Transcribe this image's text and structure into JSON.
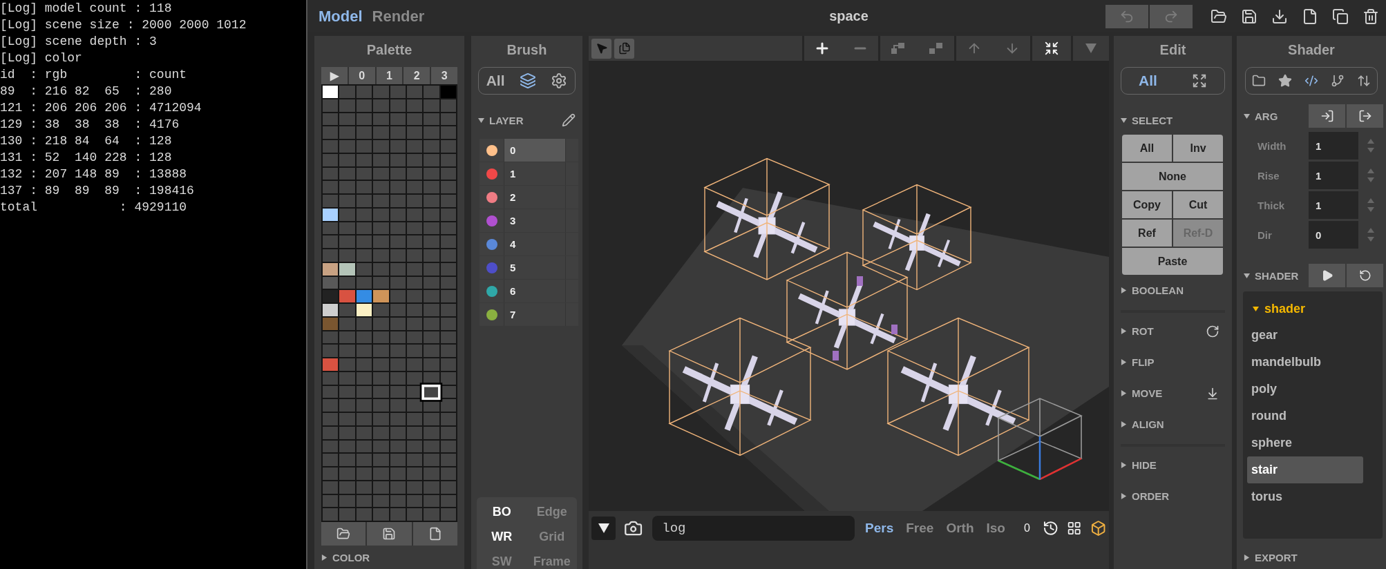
{
  "log": {
    "lines": [
      "[Log] model count : 118",
      "[Log] scene size : 2000 2000 1012",
      "[Log] scene depth : 3",
      "[Log] color",
      "id  : rgb         : count",
      "89  : 216 82  65  : 280",
      "121 : 206 206 206 : 4712094",
      "129 : 38  38  38  : 4176",
      "130 : 218 84  64  : 128",
      "131 : 52  140 228 : 128",
      "132 : 207 148 89  : 13888",
      "137 : 89  89  89  : 198416",
      "total           : 4929110"
    ]
  },
  "topbar": {
    "mode_tabs": [
      {
        "label": "Model",
        "selected": true
      },
      {
        "label": "Render",
        "selected": false
      }
    ],
    "title": "space",
    "history_buttons": [
      {
        "disabled": true
      },
      {
        "disabled": true
      }
    ]
  },
  "palette": {
    "title": "Palette",
    "pages": [
      "▶",
      "0",
      "1",
      "2",
      "3"
    ],
    "swatch_rows": [
      [
        {
          "color": "#ffffff",
          "selected": false
        },
        {
          "color": "#454545",
          "selected": false
        },
        {
          "color": "#454545",
          "selected": false
        },
        {
          "color": "#454545",
          "selected": false
        },
        {
          "color": "#454545",
          "selected": false
        },
        {
          "color": "#454545",
          "selected": false
        },
        {
          "color": "#454545",
          "selected": false
        },
        {
          "color": "#000000",
          "selected": false
        }
      ],
      [
        {
          "color": "#454545",
          "selected": false
        },
        {
          "color": "#454545",
          "selected": false
        },
        {
          "color": "#454545",
          "selected": false
        },
        {
          "color": "#454545",
          "selected": false
        },
        {
          "color": "#454545",
          "selected": false
        },
        {
          "color": "#454545",
          "selected": false
        },
        {
          "color": "#454545",
          "selected": false
        },
        {
          "color": "#454545",
          "selected": false
        }
      ],
      [
        {
          "color": "#454545",
          "selected": false
        },
        {
          "color": "#454545",
          "selected": false
        },
        {
          "color": "#454545",
          "selected": false
        },
        {
          "color": "#454545",
          "selected": false
        },
        {
          "color": "#454545",
          "selected": false
        },
        {
          "color": "#454545",
          "selected": false
        },
        {
          "color": "#454545",
          "selected": false
        },
        {
          "color": "#454545",
          "selected": false
        }
      ],
      [
        {
          "color": "#454545",
          "selected": false
        },
        {
          "color": "#454545",
          "selected": false
        },
        {
          "color": "#454545",
          "selected": false
        },
        {
          "color": "#454545",
          "selected": false
        },
        {
          "color": "#454545",
          "selected": false
        },
        {
          "color": "#454545",
          "selected": false
        },
        {
          "color": "#454545",
          "selected": false
        },
        {
          "color": "#454545",
          "selected": false
        }
      ],
      [
        {
          "color": "#454545",
          "selected": false
        },
        {
          "color": "#454545",
          "selected": false
        },
        {
          "color": "#454545",
          "selected": false
        },
        {
          "color": "#454545",
          "selected": false
        },
        {
          "color": "#454545",
          "selected": false
        },
        {
          "color": "#454545",
          "selected": false
        },
        {
          "color": "#454545",
          "selected": false
        },
        {
          "color": "#454545",
          "selected": false
        }
      ],
      [
        {
          "color": "#454545",
          "selected": false
        },
        {
          "color": "#454545",
          "selected": false
        },
        {
          "color": "#454545",
          "selected": false
        },
        {
          "color": "#454545",
          "selected": false
        },
        {
          "color": "#454545",
          "selected": false
        },
        {
          "color": "#454545",
          "selected": false
        },
        {
          "color": "#454545",
          "selected": false
        },
        {
          "color": "#454545",
          "selected": false
        }
      ],
      [
        {
          "color": "#454545",
          "selected": false
        },
        {
          "color": "#454545",
          "selected": false
        },
        {
          "color": "#454545",
          "selected": false
        },
        {
          "color": "#454545",
          "selected": false
        },
        {
          "color": "#454545",
          "selected": false
        },
        {
          "color": "#454545",
          "selected": false
        },
        {
          "color": "#454545",
          "selected": false
        },
        {
          "color": "#454545",
          "selected": false
        }
      ],
      [
        {
          "color": "#454545",
          "selected": false
        },
        {
          "color": "#454545",
          "selected": false
        },
        {
          "color": "#454545",
          "selected": false
        },
        {
          "color": "#454545",
          "selected": false
        },
        {
          "color": "#454545",
          "selected": false
        },
        {
          "color": "#454545",
          "selected": false
        },
        {
          "color": "#454545",
          "selected": false
        },
        {
          "color": "#454545",
          "selected": false
        }
      ],
      [
        {
          "color": "#454545",
          "selected": false
        },
        {
          "color": "#454545",
          "selected": false
        },
        {
          "color": "#454545",
          "selected": false
        },
        {
          "color": "#454545",
          "selected": false
        },
        {
          "color": "#454545",
          "selected": false
        },
        {
          "color": "#454545",
          "selected": false
        },
        {
          "color": "#454545",
          "selected": false
        },
        {
          "color": "#454545",
          "selected": false
        }
      ],
      [
        {
          "color": "#a8d0ff",
          "selected": false
        },
        {
          "color": "#454545",
          "selected": false
        },
        {
          "color": "#454545",
          "selected": false
        },
        {
          "color": "#454545",
          "selected": false
        },
        {
          "color": "#454545",
          "selected": false
        },
        {
          "color": "#454545",
          "selected": false
        },
        {
          "color": "#454545",
          "selected": false
        },
        {
          "color": "#454545",
          "selected": false
        }
      ],
      [
        {
          "color": "#454545",
          "selected": false
        },
        {
          "color": "#454545",
          "selected": false
        },
        {
          "color": "#454545",
          "selected": false
        },
        {
          "color": "#454545",
          "selected": false
        },
        {
          "color": "#454545",
          "selected": false
        },
        {
          "color": "#454545",
          "selected": false
        },
        {
          "color": "#454545",
          "selected": false
        },
        {
          "color": "#454545",
          "selected": false
        }
      ],
      [
        {
          "color": "#454545",
          "selected": false
        },
        {
          "color": "#454545",
          "selected": false
        },
        {
          "color": "#454545",
          "selected": false
        },
        {
          "color": "#454545",
          "selected": false
        },
        {
          "color": "#454545",
          "selected": false
        },
        {
          "color": "#454545",
          "selected": false
        },
        {
          "color": "#454545",
          "selected": false
        },
        {
          "color": "#454545",
          "selected": false
        }
      ],
      [
        {
          "color": "#454545",
          "selected": false
        },
        {
          "color": "#454545",
          "selected": false
        },
        {
          "color": "#454545",
          "selected": false
        },
        {
          "color": "#454545",
          "selected": false
        },
        {
          "color": "#454545",
          "selected": false
        },
        {
          "color": "#454545",
          "selected": false
        },
        {
          "color": "#454545",
          "selected": false
        },
        {
          "color": "#454545",
          "selected": false
        }
      ],
      [
        {
          "color": "#c8a283",
          "selected": false
        },
        {
          "color": "#b4c4b8",
          "selected": false
        },
        {
          "color": "#454545",
          "selected": false
        },
        {
          "color": "#454545",
          "selected": false
        },
        {
          "color": "#454545",
          "selected": false
        },
        {
          "color": "#454545",
          "selected": false
        },
        {
          "color": "#454545",
          "selected": false
        },
        {
          "color": "#454545",
          "selected": false
        }
      ],
      [
        {
          "color": "#595959",
          "selected": false
        },
        {
          "color": "#454545",
          "selected": false
        },
        {
          "color": "#454545",
          "selected": false
        },
        {
          "color": "#454545",
          "selected": false
        },
        {
          "color": "#454545",
          "selected": false
        },
        {
          "color": "#454545",
          "selected": false
        },
        {
          "color": "#454545",
          "selected": false
        },
        {
          "color": "#454545",
          "selected": false
        }
      ],
      [
        {
          "color": "#222222",
          "selected": false
        },
        {
          "color": "#d85241",
          "selected": false
        },
        {
          "color": "#348ce4",
          "selected": false
        },
        {
          "color": "#cf9459",
          "selected": false
        },
        {
          "color": "#454545",
          "selected": false
        },
        {
          "color": "#454545",
          "selected": false
        },
        {
          "color": "#454545",
          "selected": false
        },
        {
          "color": "#454545",
          "selected": false
        }
      ],
      [
        {
          "color": "#cecece",
          "selected": false
        },
        {
          "color": "#454545",
          "selected": false
        },
        {
          "color": "#fbf0c4",
          "selected": false
        },
        {
          "color": "#454545",
          "selected": false
        },
        {
          "color": "#454545",
          "selected": false
        },
        {
          "color": "#454545",
          "selected": false
        },
        {
          "color": "#454545",
          "selected": false
        },
        {
          "color": "#454545",
          "selected": false
        }
      ],
      [
        {
          "color": "#7a5630",
          "selected": false
        },
        {
          "color": "#454545",
          "selected": false
        },
        {
          "color": "#454545",
          "selected": false
        },
        {
          "color": "#454545",
          "selected": false
        },
        {
          "color": "#454545",
          "selected": false
        },
        {
          "color": "#454545",
          "selected": false
        },
        {
          "color": "#454545",
          "selected": false
        },
        {
          "color": "#454545",
          "selected": false
        }
      ],
      [
        {
          "color": "#454545",
          "selected": false
        },
        {
          "color": "#454545",
          "selected": false
        },
        {
          "color": "#454545",
          "selected": false
        },
        {
          "color": "#454545",
          "selected": false
        },
        {
          "color": "#454545",
          "selected": false
        },
        {
          "color": "#454545",
          "selected": false
        },
        {
          "color": "#454545",
          "selected": false
        },
        {
          "color": "#454545",
          "selected": false
        }
      ],
      [
        {
          "color": "#454545",
          "selected": false
        },
        {
          "color": "#454545",
          "selected": false
        },
        {
          "color": "#454545",
          "selected": false
        },
        {
          "color": "#454545",
          "selected": false
        },
        {
          "color": "#454545",
          "selected": false
        },
        {
          "color": "#454545",
          "selected": false
        },
        {
          "color": "#454545",
          "selected": false
        },
        {
          "color": "#454545",
          "selected": false
        }
      ],
      [
        {
          "color": "#d85241",
          "selected": false
        },
        {
          "color": "#454545",
          "selected": false
        },
        {
          "color": "#454545",
          "selected": false
        },
        {
          "color": "#454545",
          "selected": false
        },
        {
          "color": "#454545",
          "selected": false
        },
        {
          "color": "#454545",
          "selected": false
        },
        {
          "color": "#454545",
          "selected": false
        },
        {
          "color": "#454545",
          "selected": false
        }
      ],
      [
        {
          "color": "#454545",
          "selected": false
        },
        {
          "color": "#454545",
          "selected": false
        },
        {
          "color": "#454545",
          "selected": false
        },
        {
          "color": "#454545",
          "selected": false
        },
        {
          "color": "#454545",
          "selected": false
        },
        {
          "color": "#454545",
          "selected": false
        },
        {
          "color": "#454545",
          "selected": false
        },
        {
          "color": "#454545",
          "selected": false
        }
      ],
      [
        {
          "color": "#454545",
          "selected": false
        },
        {
          "color": "#454545",
          "selected": false
        },
        {
          "color": "#454545",
          "selected": false
        },
        {
          "color": "#454545",
          "selected": false
        },
        {
          "color": "#454545",
          "selected": false
        },
        {
          "color": "#454545",
          "selected": false
        },
        {
          "color": "#454545",
          "selected": true
        },
        {
          "color": "#454545",
          "selected": false
        }
      ],
      [
        {
          "color": "#454545",
          "selected": false
        },
        {
          "color": "#454545",
          "selected": false
        },
        {
          "color": "#454545",
          "selected": false
        },
        {
          "color": "#454545",
          "selected": false
        },
        {
          "color": "#454545",
          "selected": false
        },
        {
          "color": "#454545",
          "selected": false
        },
        {
          "color": "#454545",
          "selected": false
        },
        {
          "color": "#454545",
          "selected": false
        }
      ],
      [
        {
          "color": "#454545",
          "selected": false
        },
        {
          "color": "#454545",
          "selected": false
        },
        {
          "color": "#454545",
          "selected": false
        },
        {
          "color": "#454545",
          "selected": false
        },
        {
          "color": "#454545",
          "selected": false
        },
        {
          "color": "#454545",
          "selected": false
        },
        {
          "color": "#454545",
          "selected": false
        },
        {
          "color": "#454545",
          "selected": false
        }
      ],
      [
        {
          "color": "#454545",
          "selected": false
        },
        {
          "color": "#454545",
          "selected": false
        },
        {
          "color": "#454545",
          "selected": false
        },
        {
          "color": "#454545",
          "selected": false
        },
        {
          "color": "#454545",
          "selected": false
        },
        {
          "color": "#454545",
          "selected": false
        },
        {
          "color": "#454545",
          "selected": false
        },
        {
          "color": "#454545",
          "selected": false
        }
      ],
      [
        {
          "color": "#454545",
          "selected": false
        },
        {
          "color": "#454545",
          "selected": false
        },
        {
          "color": "#454545",
          "selected": false
        },
        {
          "color": "#454545",
          "selected": false
        },
        {
          "color": "#454545",
          "selected": false
        },
        {
          "color": "#454545",
          "selected": false
        },
        {
          "color": "#454545",
          "selected": false
        },
        {
          "color": "#454545",
          "selected": false
        }
      ],
      [
        {
          "color": "#454545",
          "selected": false
        },
        {
          "color": "#454545",
          "selected": false
        },
        {
          "color": "#454545",
          "selected": false
        },
        {
          "color": "#454545",
          "selected": false
        },
        {
          "color": "#454545",
          "selected": false
        },
        {
          "color": "#454545",
          "selected": false
        },
        {
          "color": "#454545",
          "selected": false
        },
        {
          "color": "#454545",
          "selected": false
        }
      ],
      [
        {
          "color": "#454545",
          "selected": false
        },
        {
          "color": "#454545",
          "selected": false
        },
        {
          "color": "#454545",
          "selected": false
        },
        {
          "color": "#454545",
          "selected": false
        },
        {
          "color": "#454545",
          "selected": false
        },
        {
          "color": "#454545",
          "selected": false
        },
        {
          "color": "#454545",
          "selected": false
        },
        {
          "color": "#454545",
          "selected": false
        }
      ],
      [
        {
          "color": "#454545",
          "selected": false
        },
        {
          "color": "#454545",
          "selected": false
        },
        {
          "color": "#454545",
          "selected": false
        },
        {
          "color": "#454545",
          "selected": false
        },
        {
          "color": "#454545",
          "selected": false
        },
        {
          "color": "#454545",
          "selected": false
        },
        {
          "color": "#454545",
          "selected": false
        },
        {
          "color": "#454545",
          "selected": false
        }
      ],
      [
        {
          "color": "#454545",
          "selected": false
        },
        {
          "color": "#454545",
          "selected": false
        },
        {
          "color": "#454545",
          "selected": false
        },
        {
          "color": "#454545",
          "selected": false
        },
        {
          "color": "#454545",
          "selected": false
        },
        {
          "color": "#454545",
          "selected": false
        },
        {
          "color": "#454545",
          "selected": false
        },
        {
          "color": "#454545",
          "selected": false
        }
      ],
      [
        {
          "color": "#454545",
          "selected": false
        },
        {
          "color": "#454545",
          "selected": false
        },
        {
          "color": "#454545",
          "selected": false
        },
        {
          "color": "#454545",
          "selected": false
        },
        {
          "color": "#454545",
          "selected": false
        },
        {
          "color": "#454545",
          "selected": false
        },
        {
          "color": "#454545",
          "selected": false
        },
        {
          "color": "#454545",
          "selected": false
        }
      ]
    ],
    "section": {
      "label": "COLOR",
      "expanded": false
    }
  },
  "brush": {
    "title": "Brush",
    "modes": [
      {
        "label": "All",
        "selected": false
      },
      {
        "selected": true
      },
      {
        "selected": false
      }
    ],
    "layer_section": {
      "label": "LAYER",
      "expanded": true
    },
    "layers": [
      {
        "name": "0",
        "color": "#ffc08a",
        "selected": true
      },
      {
        "name": "1",
        "color": "#f04848",
        "selected": false
      },
      {
        "name": "2",
        "color": "#f07c84",
        "selected": false
      },
      {
        "name": "3",
        "color": "#b050d0",
        "selected": false
      },
      {
        "name": "4",
        "color": "#5a88d8",
        "selected": false
      },
      {
        "name": "5",
        "color": "#4e4ec8",
        "selected": false
      },
      {
        "name": "6",
        "color": "#2fa8a8",
        "selected": false
      },
      {
        "name": "7",
        "color": "#8ab040",
        "selected": false
      }
    ],
    "toggles": [
      {
        "label": "BO",
        "on": true
      },
      {
        "label": "Edge",
        "on": false
      },
      {
        "label": "WR",
        "on": true
      },
      {
        "label": "Grid",
        "on": false
      },
      {
        "label": "SW",
        "on": false
      },
      {
        "label": "Frame",
        "on": false
      }
    ]
  },
  "viewport": {
    "command": {
      "value": "log"
    },
    "camera_modes": [
      {
        "label": "Pers",
        "selected": true
      },
      {
        "label": "Free",
        "selected": false
      },
      {
        "label": "Orth",
        "selected": false
      },
      {
        "label": "Iso",
        "selected": false
      }
    ],
    "zoom_value": "0"
  },
  "edit": {
    "title": "Edit",
    "modes": [
      {
        "label": "All",
        "selected": true
      },
      {
        "selected": false
      }
    ],
    "select_section": {
      "label": "SELECT",
      "expanded": true
    },
    "select_rows": [
      [
        {
          "label": "All",
          "disabled": false
        },
        {
          "label": "Inv",
          "disabled": false
        }
      ],
      [
        {
          "label": "None",
          "disabled": false
        }
      ],
      [
        {
          "label": "Copy",
          "disabled": false
        },
        {
          "label": "Cut",
          "disabled": false
        }
      ],
      [
        {
          "label": "Ref",
          "disabled": false
        },
        {
          "label": "Ref-D",
          "disabled": true
        }
      ],
      [
        {
          "label": "Paste",
          "disabled": false
        }
      ]
    ],
    "section_groups": [
      [
        {
          "label": "BOOLEAN",
          "expanded": false
        }
      ],
      [
        {
          "label": "ROT",
          "expanded": false
        },
        {
          "label": "FLIP",
          "expanded": false
        },
        {
          "label": "MOVE",
          "expanded": false
        },
        {
          "label": "ALIGN",
          "expanded": false
        }
      ],
      [
        {
          "label": "HIDE",
          "expanded": false
        },
        {
          "label": "ORDER",
          "expanded": false
        }
      ]
    ]
  },
  "shader": {
    "title": "Shader",
    "tabs": [
      {
        "selected": false
      },
      {
        "selected": false
      },
      {
        "selected": true
      },
      {
        "selected": false
      },
      {
        "selected": false
      }
    ],
    "arg_section": {
      "label": "ARG",
      "expanded": true
    },
    "params": [
      {
        "name": "Width",
        "value": "1"
      },
      {
        "name": "Rise",
        "value": "1"
      },
      {
        "name": "Thick",
        "value": "1"
      },
      {
        "name": "Dir",
        "value": "0"
      }
    ],
    "shader_section": {
      "label": "SHADER",
      "expanded": true
    },
    "tree": {
      "label": "shader",
      "expanded": true,
      "children": [
        {
          "name": "gear",
          "selected": false
        },
        {
          "name": "mandelbulb",
          "selected": false
        },
        {
          "name": "poly",
          "selected": false
        },
        {
          "name": "round",
          "selected": false
        },
        {
          "name": "sphere",
          "selected": false
        },
        {
          "name": "stair",
          "selected": true
        },
        {
          "name": "torus",
          "selected": false
        }
      ]
    },
    "export_section": {
      "label": "EXPORT",
      "expanded": false
    }
  }
}
